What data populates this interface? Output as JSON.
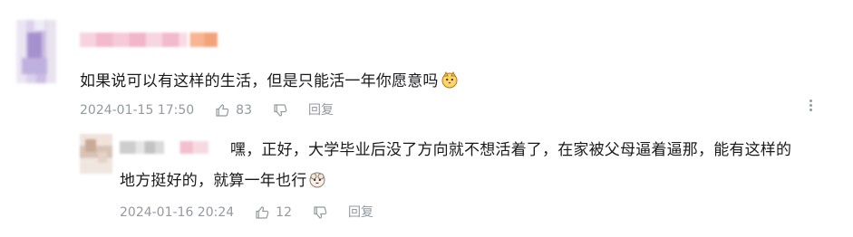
{
  "comment": {
    "text": "如果说可以有这样的生活，但是只能活一年你愿意吗",
    "emoji_icon": "shiba-dog-emoji",
    "timestamp": "2024-01-15 17:50",
    "likes": "83",
    "reply_label": "回复"
  },
  "reply": {
    "text_line1": "嘿，正好，大学毕业后没了方向就不想活着了，在家被父母逼着逼那，能有这样的",
    "text_line2": "地方挺好的，就算一年也行",
    "emoji_icon": "sheep-emoji",
    "timestamp": "2024-01-16 20:24",
    "likes": "12",
    "reply_label": "回复"
  },
  "icons": {
    "more": "more-vertical-icon",
    "like": "thumb-up-icon",
    "dislike": "thumb-down-icon"
  }
}
